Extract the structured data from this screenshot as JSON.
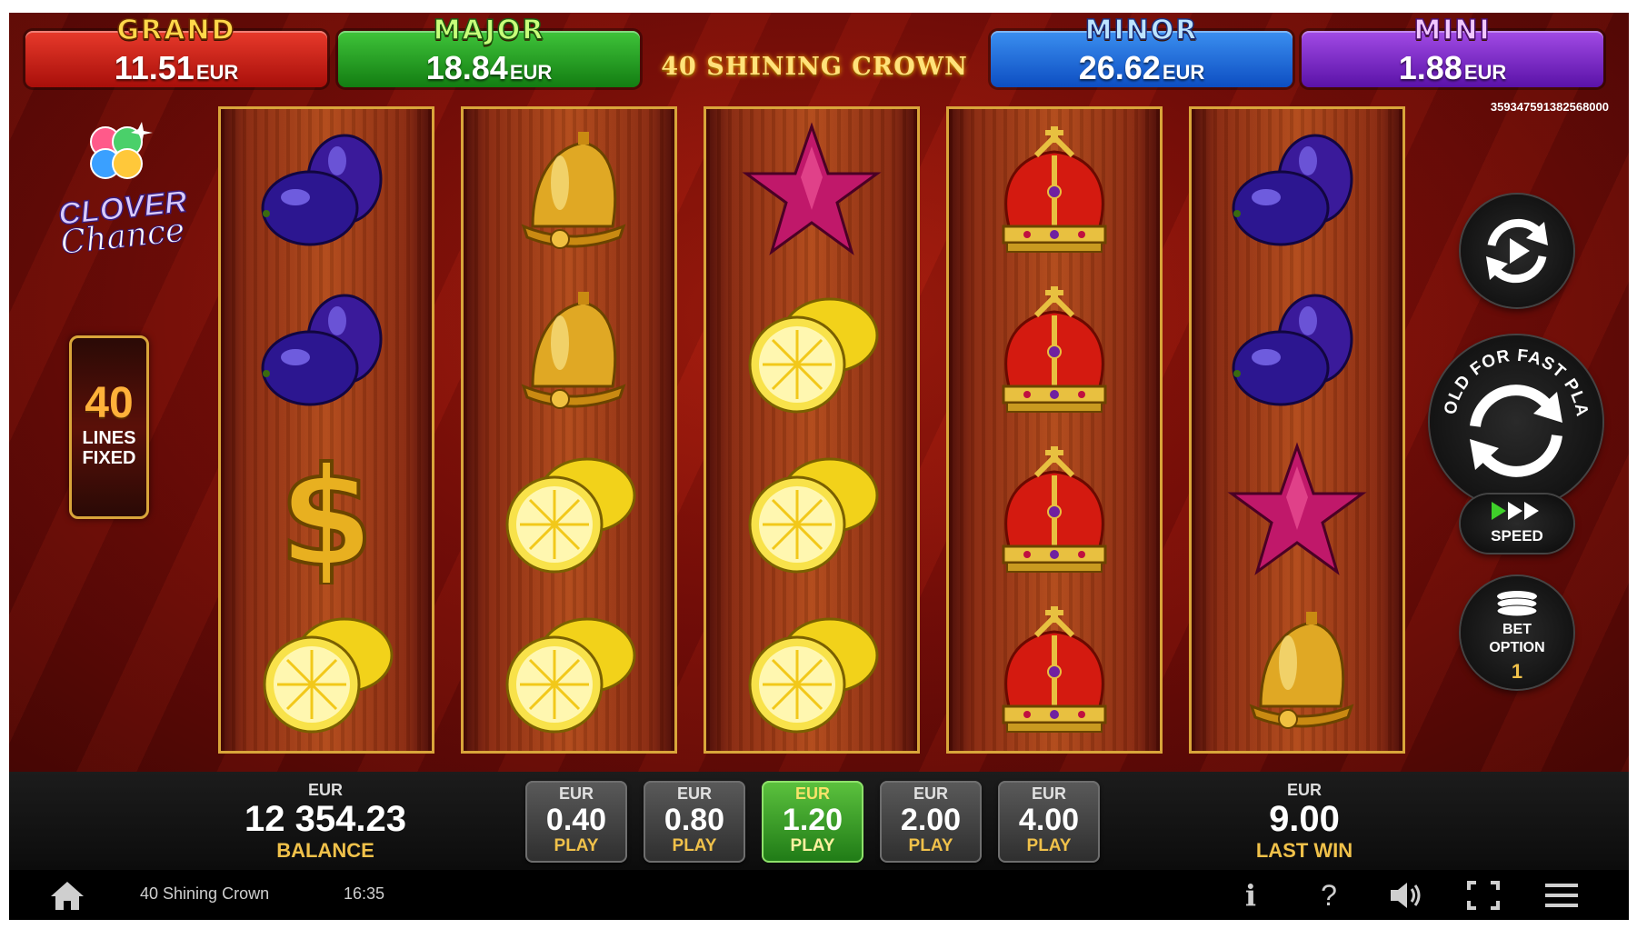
{
  "jackpots": {
    "grand": {
      "title": "GRAND",
      "value": "11.51",
      "currency": "EUR"
    },
    "major": {
      "title": "MAJOR",
      "value": "18.84",
      "currency": "EUR"
    },
    "minor": {
      "title": "MINOR",
      "value": "26.62",
      "currency": "EUR"
    },
    "mini": {
      "title": "MINI",
      "value": "1.88",
      "currency": "EUR"
    }
  },
  "game_title": "40 SHINING CROWN",
  "ticket_id": "359347591382568000",
  "logo": {
    "line1": "CLOVER",
    "line2": "Chance"
  },
  "lines": {
    "count": "40",
    "label1": "LINES",
    "label2": "FIXED"
  },
  "reels": [
    [
      "plum",
      "plum",
      "dollar",
      "lemon"
    ],
    [
      "bell",
      "bell",
      "lemon",
      "lemon"
    ],
    [
      "star",
      "lemon",
      "lemon",
      "lemon"
    ],
    [
      "crown",
      "crown",
      "crown",
      "crown"
    ],
    [
      "plum",
      "plum",
      "star",
      "bell"
    ]
  ],
  "controls": {
    "spin_hint": "HOLD FOR FAST PLAY",
    "speed_label": "SPEED",
    "bet_option_label1": "BET",
    "bet_option_label2": "OPTION",
    "bet_option_value": "1"
  },
  "balance": {
    "currency": "EUR",
    "value": "12 354.23",
    "label": "BALANCE"
  },
  "bets": [
    {
      "currency": "EUR",
      "value": "0.40",
      "label": "PLAY",
      "active": false
    },
    {
      "currency": "EUR",
      "value": "0.80",
      "label": "PLAY",
      "active": false
    },
    {
      "currency": "EUR",
      "value": "1.20",
      "label": "PLAY",
      "active": true
    },
    {
      "currency": "EUR",
      "value": "2.00",
      "label": "PLAY",
      "active": false
    },
    {
      "currency": "EUR",
      "value": "4.00",
      "label": "PLAY",
      "active": false
    }
  ],
  "last_win": {
    "currency": "EUR",
    "value": "9.00",
    "label": "LAST WIN"
  },
  "status_bar": {
    "game_name": "40 Shining Crown",
    "time": "16:35",
    "icons": [
      "home-icon",
      "info-icon",
      "help-icon",
      "volume-icon",
      "fullscreen-icon",
      "menu-icon"
    ],
    "info_glyph": "i",
    "help_glyph": "?"
  },
  "colors": {
    "accent_gold": "#d9a53a",
    "active_bet": "#3a9e2a",
    "label_gold": "#f0c14a"
  }
}
